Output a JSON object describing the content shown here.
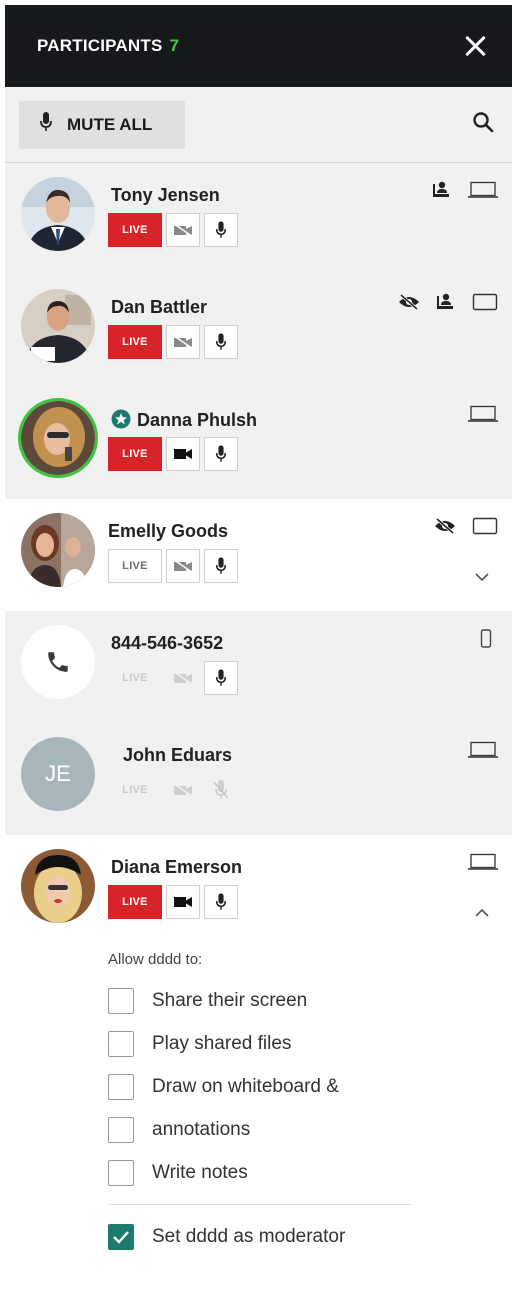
{
  "header": {
    "title": "PARTICIPANTS",
    "count": "7"
  },
  "toolbar": {
    "mute_all_label": "MUTE ALL"
  },
  "participants": [
    {
      "name": "Tony Jensen",
      "live": "LIVE"
    },
    {
      "name": "Dan Battler",
      "live": "LIVE"
    },
    {
      "name": "Danna Phulsh",
      "live": "LIVE",
      "role": "moderator"
    },
    {
      "name": "Emelly Goods",
      "live": "LIVE"
    },
    {
      "name": "844-546-3652",
      "live": "LIVE",
      "device": "phone"
    },
    {
      "name": "John Eduars",
      "initials": "JE",
      "live": "LIVE"
    },
    {
      "name": "Diana Emerson",
      "live": "LIVE"
    }
  ],
  "permissions": {
    "label": "Allow dddd to:",
    "options": [
      {
        "label": "Share their screen",
        "checked": false
      },
      {
        "label": "Play shared files",
        "checked": false
      },
      {
        "label": "Draw on whiteboard &",
        "checked": false
      },
      {
        "label": "annotations",
        "checked": false
      },
      {
        "label": "Write notes",
        "checked": false
      }
    ],
    "moderator": {
      "label": "Set dddd as moderator",
      "checked": true
    }
  },
  "colors": {
    "header_bg": "#15191c",
    "count": "#3fd13f",
    "live_on": "#d8232a",
    "moderator_ring": "#3cc43c",
    "checkbox_on": "#1d7a6e"
  }
}
